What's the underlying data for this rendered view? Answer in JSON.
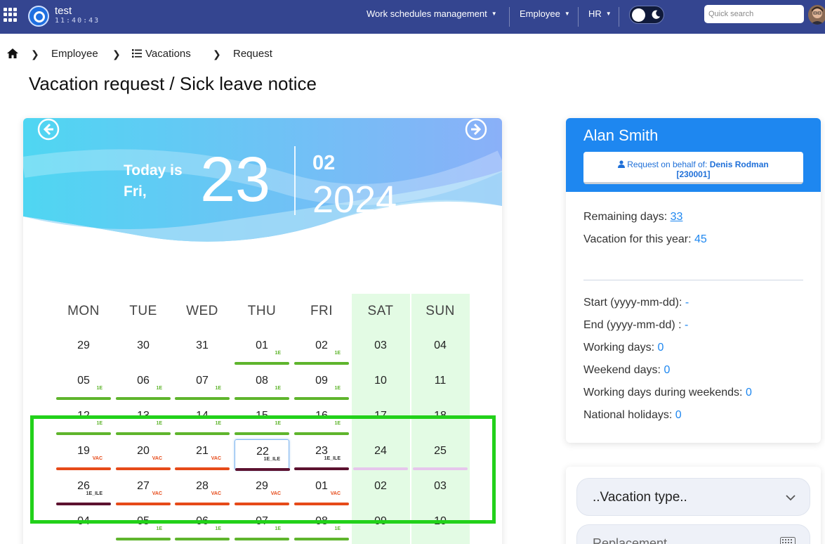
{
  "topbar": {
    "app_name": "test",
    "clock": "11:40:43",
    "nav": [
      {
        "label": "Work schedules management"
      },
      {
        "label": "Employee"
      },
      {
        "label": "HR"
      }
    ],
    "search_placeholder": "Quick search",
    "colors": {
      "bar": "#344590"
    }
  },
  "breadcrumb": {
    "items": [
      "Employee",
      "Vacations",
      "Request"
    ]
  },
  "page_title": "Vacation request / Sick leave notice",
  "calendar": {
    "today_label": "Today is Fri,",
    "day": "23",
    "month": "02",
    "year": "2024",
    "weekdays": [
      "MON",
      "TUE",
      "WED",
      "THU",
      "FRI",
      "SAT",
      "SUN"
    ],
    "tag_colors": {
      "1E": "#5fb52d",
      "VAC": "#e64a19",
      "1E_ILE": "#5c1230",
      "": "#e6c6ec"
    },
    "rows": [
      [
        "29",
        "30",
        "31",
        "01",
        "02",
        "03",
        "04"
      ],
      [
        "05",
        "06",
        "07",
        "08",
        "09",
        "10",
        "11"
      ],
      [
        "12",
        "13",
        "14",
        "15",
        "16",
        "17",
        "18"
      ],
      [
        "19",
        "20",
        "21",
        "22",
        "23",
        "24",
        "25"
      ],
      [
        "26",
        "27",
        "28",
        "29",
        "01",
        "02",
        "03"
      ],
      [
        "04",
        "05",
        "06",
        "07",
        "08",
        "09",
        "10"
      ]
    ],
    "tags": [
      [
        "",
        "",
        "",
        "1E",
        "1E",
        "",
        ""
      ],
      [
        "1E",
        "1E",
        "1E",
        "1E",
        "1E",
        "",
        ""
      ],
      [
        "1E",
        "1E",
        "1E",
        "1E",
        "1E",
        "",
        ""
      ],
      [
        "VAC",
        "VAC",
        "VAC",
        "1E_ILE",
        "1E_ILE",
        "-",
        "-"
      ],
      [
        "1E_ILE",
        "VAC",
        "VAC",
        "VAC",
        "VAC",
        "",
        ""
      ],
      [
        "",
        "1E",
        "1E",
        "1E",
        "1E",
        "",
        ""
      ]
    ],
    "selected": "22"
  },
  "employee": {
    "name": "Alan Smith",
    "behalf_prefix": "Request on behalf of:",
    "behalf_name": "Denis Rodman",
    "behalf_id": "[230001]",
    "remaining_label": "Remaining days:",
    "remaining_value": "33",
    "vacation_year_label": "Vacation for this year:",
    "vacation_year_value": "45",
    "start_label": "Start (yyyy-mm-dd):",
    "start_value": "-",
    "end_label": "End (yyyy-mm-dd) :",
    "end_value": "-",
    "working_days_label": "Working days:",
    "working_days_value": "0",
    "weekend_days_label": "Weekend days:",
    "weekend_days_value": "0",
    "working_weekends_label": "Working days during weekends:",
    "working_weekends_value": "0",
    "holidays_label": "National holidays:",
    "holidays_value": "0"
  },
  "form": {
    "vacation_type_placeholder": "..Vacation type..",
    "replacement_placeholder": "Replacement"
  }
}
